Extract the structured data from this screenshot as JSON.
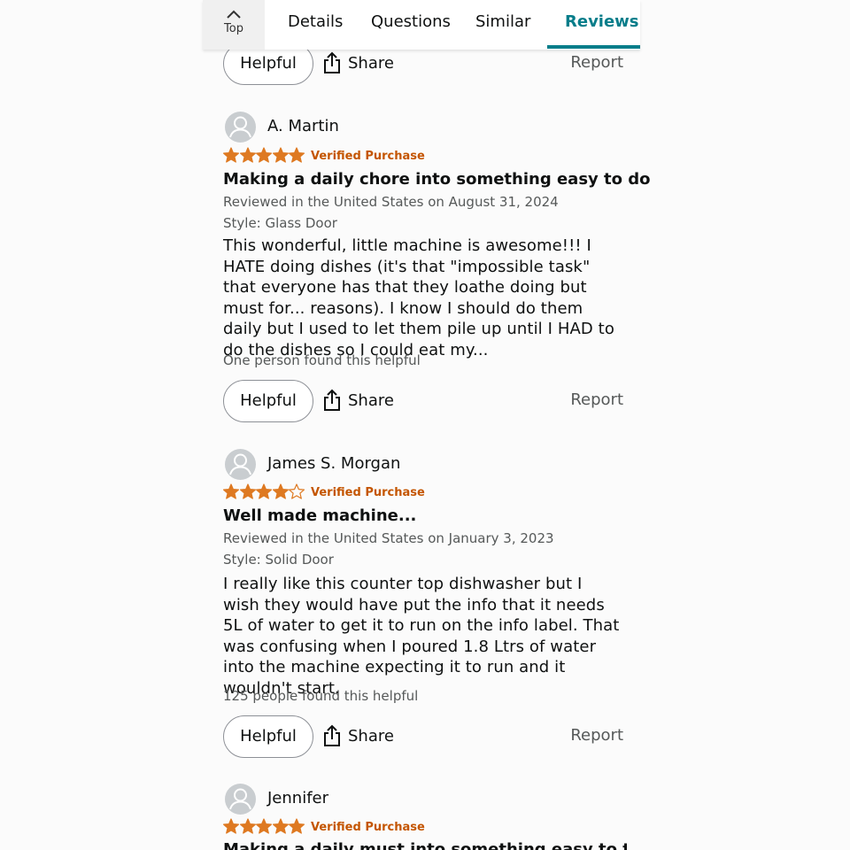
{
  "tabs": {
    "top_label": "Top",
    "items": [
      {
        "label": "Details"
      },
      {
        "label": "Questions"
      },
      {
        "label": "Similar"
      },
      {
        "label": "Reviews",
        "active": true
      }
    ]
  },
  "colors": {
    "accent": "#067d8a",
    "star": "#de7921",
    "verified": "#c45500",
    "muted_text": "#565959"
  },
  "actions": {
    "helpful_label": "Helpful",
    "share_label": "Share",
    "report_label": "Report"
  },
  "reviews": [
    {
      "author": "A. Martin",
      "rating": 5,
      "verified": "Verified Purchase",
      "title": "Making a daily chore into something easy to do",
      "reviewed": "Reviewed in the United States on August 31, 2024",
      "style": "Style: Glass Door",
      "body": "This wonderful, little machine is awesome!!! I HATE doing dishes (it's that \"impossible task\" that everyone has that they loathe doing but must for... reasons). I know I should do them daily but I used to let them pile up until I HAD to do the dishes so I could eat my...",
      "helpful_count": "One person found this helpful"
    },
    {
      "author": "James S. Morgan",
      "rating": 4,
      "verified": "Verified Purchase",
      "title": "Well made machine...",
      "reviewed": "Reviewed in the United States on January 3, 2023",
      "style": "Style: Solid Door",
      "body": "I really like this counter top dishwasher but I wish they would have put the info that it needs 5L of water to get it to run on the info label. That was confusing when I poured 1.8 Ltrs of water into the machine expecting it to run and it wouldn't start.",
      "helpful_count": "125 people found this helpful"
    },
    {
      "author": "Jennifer",
      "rating": 5,
      "verified": "Verified Purchase",
      "title": "Making a daily must into something easy to the"
    }
  ]
}
